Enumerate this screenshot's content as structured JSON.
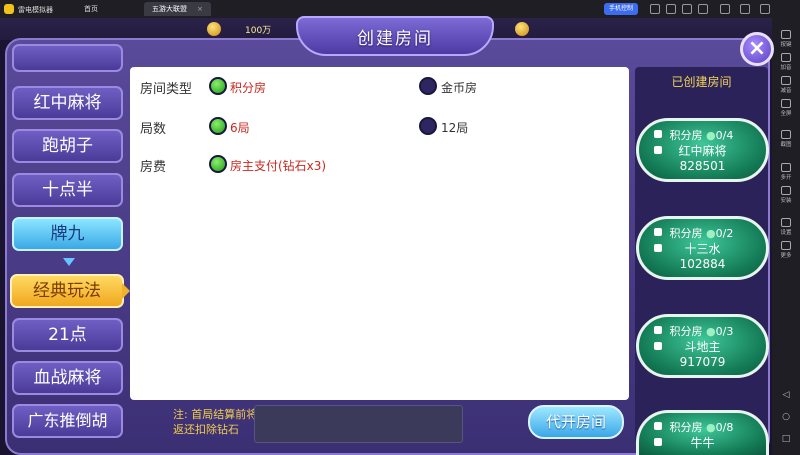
{
  "emulator": {
    "app_name": "雷电模拟器",
    "tabs": [
      {
        "label": "首页"
      },
      {
        "label": "五游大联盟"
      }
    ],
    "control_button": "手机控制",
    "side_tools": [
      "按键",
      "加音",
      "减音",
      "全屏",
      "截图",
      "多开",
      "安装",
      "设置",
      "更多"
    ]
  },
  "game_bar": {
    "coin_text": "100万"
  },
  "dialog": {
    "title": "创建房间",
    "close_icon": "×"
  },
  "game_types": [
    {
      "label": "",
      "state": "normal"
    },
    {
      "label": "红中麻将",
      "state": "normal"
    },
    {
      "label": "跑胡子",
      "state": "normal"
    },
    {
      "label": "十点半",
      "state": "normal"
    },
    {
      "label": "牌九",
      "state": "active"
    },
    {
      "label": "经典玩法",
      "state": "sub-selected"
    },
    {
      "label": "21点",
      "state": "normal"
    },
    {
      "label": "血战麻将",
      "state": "normal"
    },
    {
      "label": "广东推倒胡",
      "state": "normal"
    }
  ],
  "options": {
    "room_type": {
      "label": "房间类型",
      "choices": [
        {
          "text": "积分房",
          "selected": true
        },
        {
          "text": "金币房",
          "selected": false
        }
      ]
    },
    "rounds": {
      "label": "局数",
      "choices": [
        {
          "text": "6局",
          "selected": true
        },
        {
          "text": "12局",
          "selected": false
        }
      ]
    },
    "fee": {
      "label": "房费",
      "choices": [
        {
          "text": "房主支付(钻石x3)",
          "selected": true
        }
      ]
    }
  },
  "note": {
    "line1": "注: 首局结算前将",
    "line2": "返还扣除钻石"
  },
  "open_room_button": "代开房间",
  "created_rooms": {
    "title": "已创建房间",
    "rooms": [
      {
        "type": "积分房",
        "players": "0/4",
        "game": "红中麻将",
        "code": "828501"
      },
      {
        "type": "积分房",
        "players": "0/2",
        "game": "十三水",
        "code": "102884"
      },
      {
        "type": "积分房",
        "players": "0/3",
        "game": "斗地主",
        "code": "917079"
      },
      {
        "type": "积分房",
        "players": "0/8",
        "game": "牛牛",
        "code": ""
      }
    ]
  },
  "colors": {
    "selected_text": "#c8281e",
    "accent_gold": "#f4cf48",
    "panel_purple": "#4b3b98"
  }
}
